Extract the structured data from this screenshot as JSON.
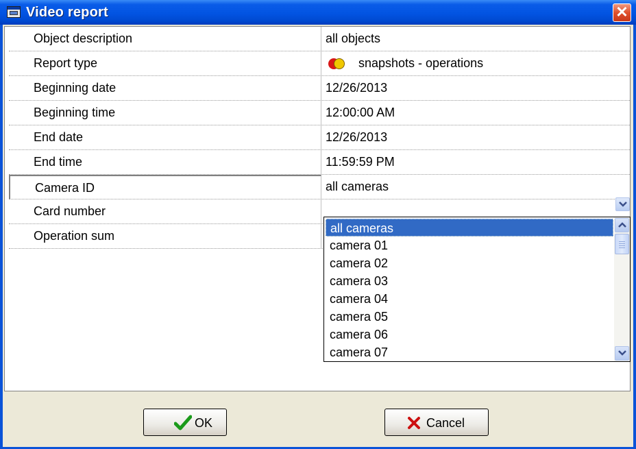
{
  "window": {
    "title": "Video report",
    "title_icon": "report-window-icon",
    "close_icon": "close-icon"
  },
  "properties": [
    {
      "label": "Object description",
      "value": "all objects"
    },
    {
      "label": "Report type",
      "value": "snapshots - operations",
      "icon": "snapshot-operations-icon"
    },
    {
      "label": "Beginning date",
      "value": "12/26/2013"
    },
    {
      "label": "Beginning time",
      "value": "12:00:00 AM"
    },
    {
      "label": "End date",
      "value": "12/26/2013"
    },
    {
      "label": "End time",
      "value": "11:59:59 PM"
    },
    {
      "label": "Camera ID",
      "value": "all cameras",
      "selected": true
    },
    {
      "label": "Card number",
      "value": ""
    },
    {
      "label": "Operation sum",
      "value": ""
    }
  ],
  "dropdown": {
    "selected": "all cameras",
    "options": [
      "all cameras",
      "camera 01",
      "camera 02",
      "camera 03",
      "camera 04",
      "camera 05",
      "camera 06",
      "camera 07"
    ]
  },
  "buttons": {
    "ok": "OK",
    "cancel": "Cancel"
  },
  "colors": {
    "title_bar": "#0254e2",
    "selection": "#316ac5",
    "face": "#ece9d8"
  }
}
